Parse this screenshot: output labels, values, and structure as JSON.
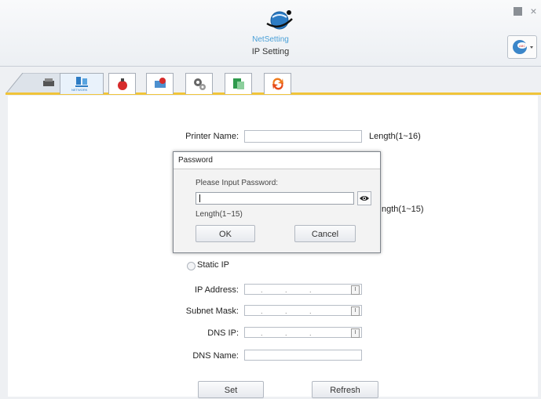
{
  "app": {
    "name": "NetSetting",
    "subtitle": "IP Setting"
  },
  "tabs": [
    {
      "name": "printer"
    },
    {
      "name": "network",
      "label": "NETWORK",
      "active": true
    },
    {
      "name": "bell"
    },
    {
      "name": "alert"
    },
    {
      "name": "settings"
    },
    {
      "name": "file"
    },
    {
      "name": "refresh"
    }
  ],
  "form": {
    "printer_name_label": "Printer Name:",
    "printer_name_value": "",
    "printer_name_hint": "Length(1~16)",
    "length_hint_partial": "ngth(1~15)",
    "static_ip_label": "Static IP",
    "ip_address_label": "IP Address:",
    "subnet_mask_label": "Subnet Mask:",
    "dns_ip_label": "DNS IP:",
    "dns_name_label": "DNS Name:",
    "dns_name_value": "",
    "ip_placeholder": ". . .",
    "ip_btn": "I",
    "set_label": "Set",
    "refresh_label": "Refresh"
  },
  "dialog": {
    "title": "Password",
    "prompt": "Please Input Password:",
    "value": "",
    "length_hint": "Length(1~15)",
    "ok_label": "OK",
    "cancel_label": "Cancel"
  }
}
